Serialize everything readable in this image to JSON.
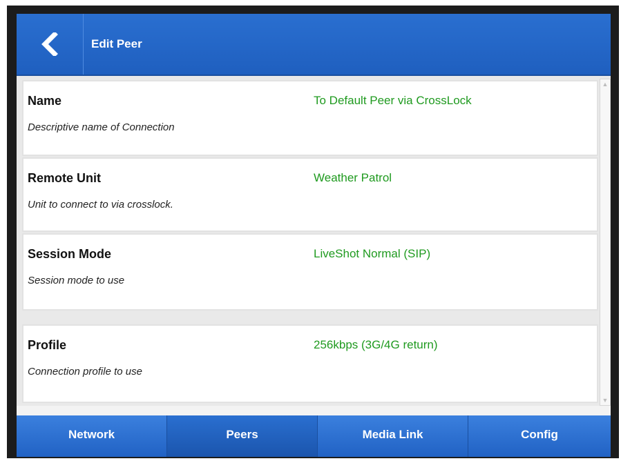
{
  "header": {
    "back_icon": "chevron-left-icon",
    "title": "Edit Peer"
  },
  "fields": [
    {
      "label": "Name",
      "description": "Descriptive name of Connection",
      "value": "To Default Peer via CrossLock"
    },
    {
      "label": "Remote Unit",
      "description": "Unit to connect to via crosslock.",
      "value": "Weather Patrol"
    },
    {
      "label": "Session Mode",
      "description": "Session mode to use",
      "value": "LiveShot Normal (SIP)"
    },
    {
      "label": "Profile",
      "description": "Connection profile to use",
      "value": "256kbps (3G/4G return)"
    }
  ],
  "tabs": [
    {
      "label": "Network"
    },
    {
      "label": "Peers"
    },
    {
      "label": "Media Link"
    },
    {
      "label": "Config"
    }
  ],
  "colors": {
    "header_blue": "#1f5fbf",
    "value_green": "#1f9a1f",
    "tab_blue": "#2162c4"
  }
}
